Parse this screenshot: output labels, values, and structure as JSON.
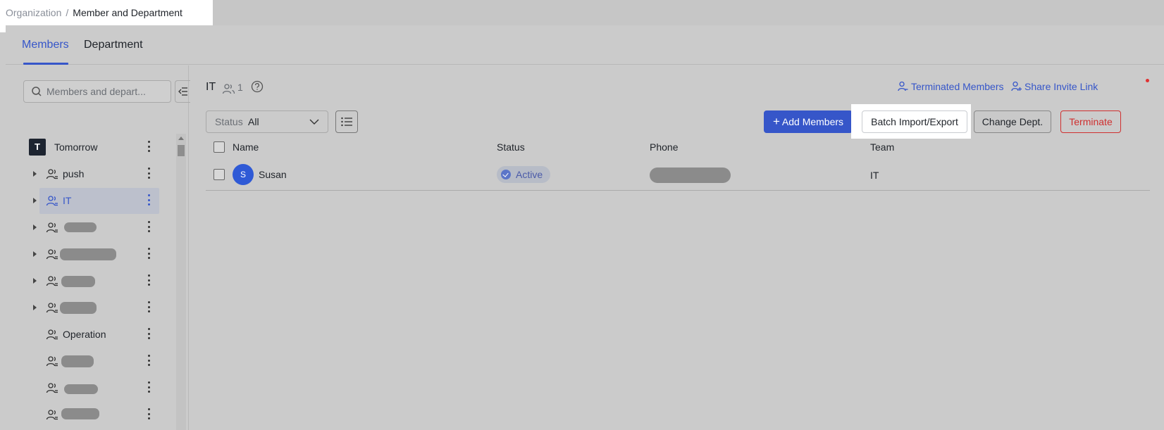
{
  "breadcrumb": {
    "parent": "Organization",
    "separator": "/",
    "current": "Member and Department"
  },
  "tabs": [
    {
      "label": "Members",
      "active": true
    },
    {
      "label": "Department",
      "active": false
    }
  ],
  "sidebar": {
    "search_placeholder": "Members and depart...",
    "org": {
      "initial": "T",
      "label": "Tomorrow"
    },
    "items": [
      {
        "label": "push",
        "expandable": true
      },
      {
        "label": "IT",
        "expandable": true,
        "selected": true
      },
      {
        "label": "",
        "expandable": true,
        "redacted": true
      },
      {
        "label": "",
        "expandable": true,
        "redacted": true
      },
      {
        "label": "",
        "expandable": true,
        "redacted": true
      },
      {
        "label": "",
        "expandable": true,
        "redacted": true
      },
      {
        "label": "Operation",
        "expandable": false
      },
      {
        "label": "",
        "expandable": false,
        "redacted": true
      },
      {
        "label": "",
        "expandable": false,
        "redacted": true
      },
      {
        "label": "",
        "expandable": false,
        "redacted": true
      }
    ]
  },
  "header": {
    "dept_name": "IT",
    "member_count": "1",
    "terminated_link": "Terminated Members",
    "invite_link": "Share Invite Link"
  },
  "toolbar": {
    "status_label": "Status",
    "status_value": "All",
    "add_members": "Add Members",
    "batch": "Batch Import/Export",
    "change_dept": "Change Dept.",
    "terminate": "Terminate"
  },
  "table": {
    "columns": [
      "Name",
      "Status",
      "Phone",
      "Team"
    ],
    "rows": [
      {
        "initial": "S",
        "name": "Susan",
        "status": "Active",
        "phone": "",
        "team": "IT"
      }
    ]
  },
  "colors": {
    "accent": "#3656c9",
    "danger": "#cf2f2f",
    "overlay": "#cbcbcb"
  }
}
